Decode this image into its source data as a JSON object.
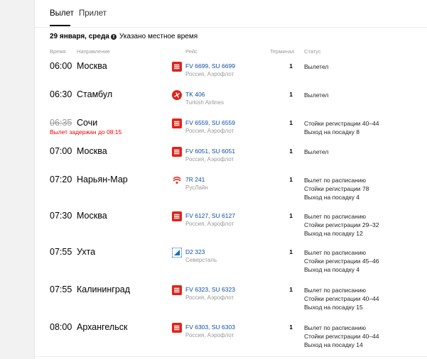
{
  "tabs": [
    {
      "label": "Вылет",
      "active": true
    },
    {
      "label": "Прилет",
      "active": false
    }
  ],
  "date_label": "29 января, среда",
  "timezone_note": "Указано местное время",
  "columns": {
    "time": "Время",
    "destination": "Направление",
    "flight": "Рейс",
    "terminal": "Терминал",
    "status": "Статус"
  },
  "flights": [
    {
      "time": "06:00",
      "destination": "Москва",
      "logo": "aeroflot",
      "flight": "FV 6699, SU 6699",
      "airline": "Россия, Аэрофлот",
      "terminal": "1",
      "status": [
        "Вылетел"
      ]
    },
    {
      "time": "06:30",
      "destination": "Стамбул",
      "logo": "turkish",
      "flight": "TK 406",
      "airline": "Turkish Airlines",
      "terminal": "1",
      "status": [
        "Вылетел"
      ]
    },
    {
      "time": "06:35",
      "time_struck": true,
      "delay": "Вылет задержан до 08:15",
      "destination": "Сочи",
      "logo": "aeroflot",
      "flight": "FV 6559, SU 6559",
      "airline": "Россия, Аэрофлот",
      "terminal": "1",
      "status": [
        "Стойки регистрации 40–44",
        "Выход на посадку 8"
      ]
    },
    {
      "time": "07:00",
      "destination": "Москва",
      "logo": "aeroflot",
      "flight": "FV 6051, SU 6051",
      "airline": "Россия, Аэрофлот",
      "terminal": "1",
      "status": [
        "Вылетел"
      ]
    },
    {
      "time": "07:20",
      "destination": "Нарьян-Мар",
      "logo": "rusline",
      "flight": "7R 241",
      "airline": "РусЛайн",
      "terminal": "1",
      "status": [
        "Вылет по расписанию",
        "Стойки регистрации 78",
        "Выход на посадку 4"
      ]
    },
    {
      "time": "07:30",
      "destination": "Москва",
      "logo": "aeroflot",
      "flight": "FV 6127, SU 6127",
      "airline": "Россия, Аэрофлот",
      "terminal": "1",
      "status": [
        "Вылет по расписанию",
        "Стойки регистрации 29–32",
        "Выход на посадку 12"
      ]
    },
    {
      "time": "07:55",
      "destination": "Ухта",
      "logo": "severstal",
      "flight": "D2 323",
      "airline": "Северсталь",
      "terminal": "1",
      "status": [
        "Вылет по расписанию",
        "Стойки регистрации 45–46",
        "Выход на посадку 4"
      ]
    },
    {
      "time": "07:55",
      "destination": "Калининград",
      "logo": "aeroflot",
      "flight": "FV 6323, SU 6323",
      "airline": "Россия, Аэрофлот",
      "terminal": "1",
      "status": [
        "Вылет по расписанию",
        "Стойки регистрации 40–44",
        "Выход на посадку 15"
      ]
    },
    {
      "time": "08:00",
      "destination": "Архангельск",
      "logo": "aeroflot",
      "flight": "FV 6303, SU 6303",
      "airline": "Россия, Аэрофлот",
      "terminal": "1",
      "status": [
        "Вылет по расписанию",
        "Стойки регистрации 40–44",
        "Выход на посадку 14"
      ]
    }
  ]
}
